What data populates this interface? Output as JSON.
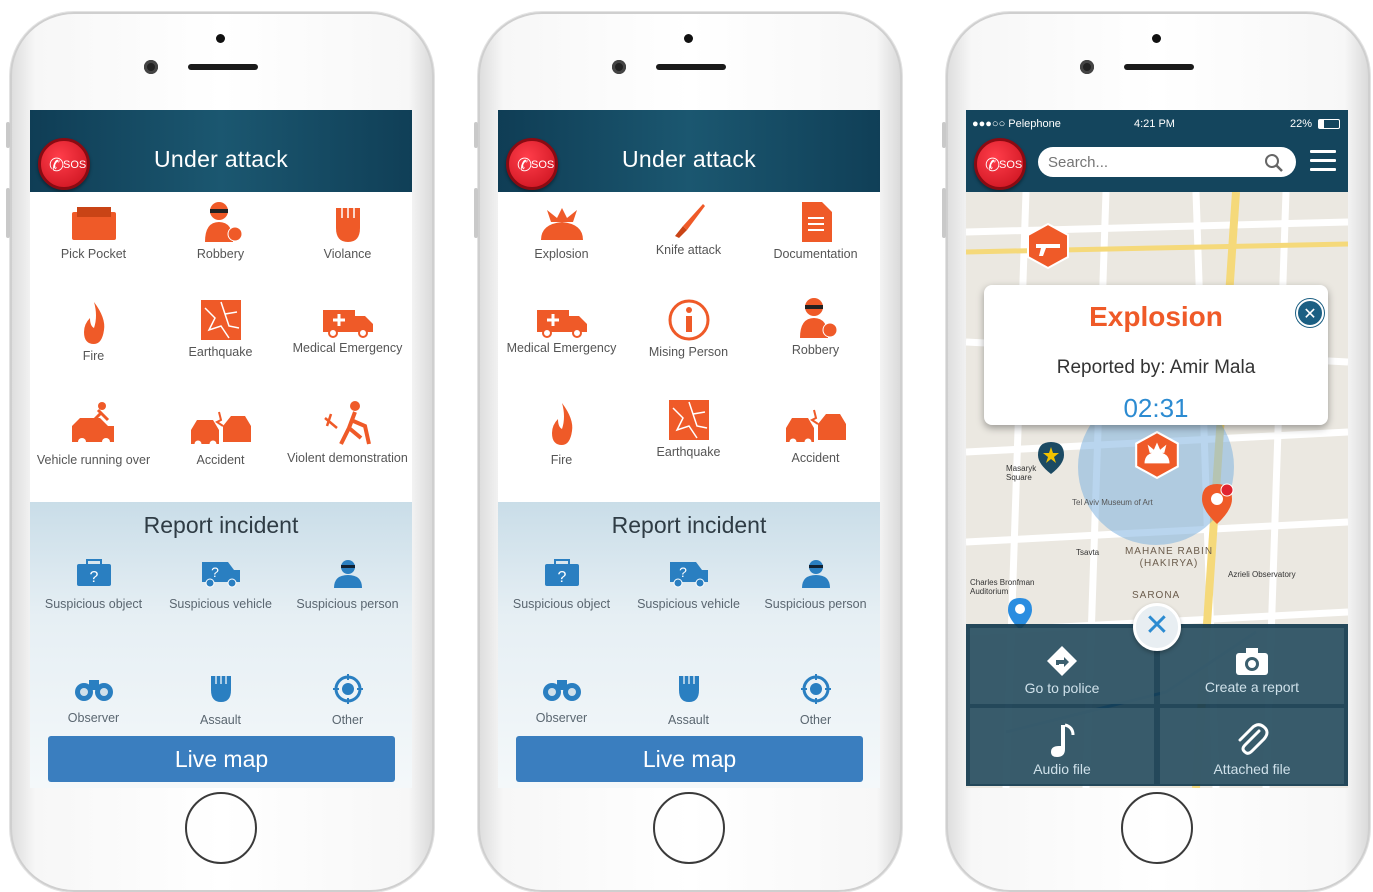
{
  "screen1": {
    "title": "Under attack",
    "sos": "SOS",
    "incidents": [
      "Pick Pocket",
      "Robbery",
      "Violance",
      "Fire",
      "Earthquake",
      "Medical Emergency",
      "Vehicle running over",
      "Accident",
      "Violent demonstration"
    ],
    "report_title": "Report incident",
    "reports": [
      "Suspicious object",
      "Suspicious vehicle",
      "Suspicious person",
      "Observer",
      "Assault",
      "Other"
    ],
    "live_map": "Live map"
  },
  "screen2": {
    "title": "Under attack",
    "sos": "SOS",
    "incidents": [
      "Explosion",
      "Knife attack",
      "Documentation",
      "Medical Emergency",
      "Mising Person",
      "Robbery",
      "Fire",
      "Earthquake",
      "Accident"
    ],
    "report_title": "Report incident",
    "reports": [
      "Suspicious object",
      "Suspicious vehicle",
      "Suspicious person",
      "Observer",
      "Assault",
      "Other"
    ],
    "live_map": "Live map"
  },
  "screen3": {
    "status": {
      "carrier": "●●●○○ Pelephone",
      "time": "4:21 PM",
      "battery": "22%"
    },
    "sos": "SOS",
    "search_placeholder": "Search...",
    "popup": {
      "title": "Explosion",
      "reported_by": "Reported by: Amir Mala",
      "timer": "02:31"
    },
    "map_labels": [
      "MAHANE RABIN (HAKIRYA)",
      "SARONA",
      "Tel Aviv Museum of Art",
      "Azrieli Observatory",
      "Charles Bronfman Auditorium",
      "Tsavta",
      "Masaryk Square"
    ],
    "actions": [
      "Go to police",
      "Create a report",
      "Audio file",
      "Attached file"
    ]
  },
  "colors": {
    "header": "#14455d",
    "accent": "#ef5a28",
    "icon_blue": "#2a7fc1",
    "live_map": "#3a7ebf"
  }
}
